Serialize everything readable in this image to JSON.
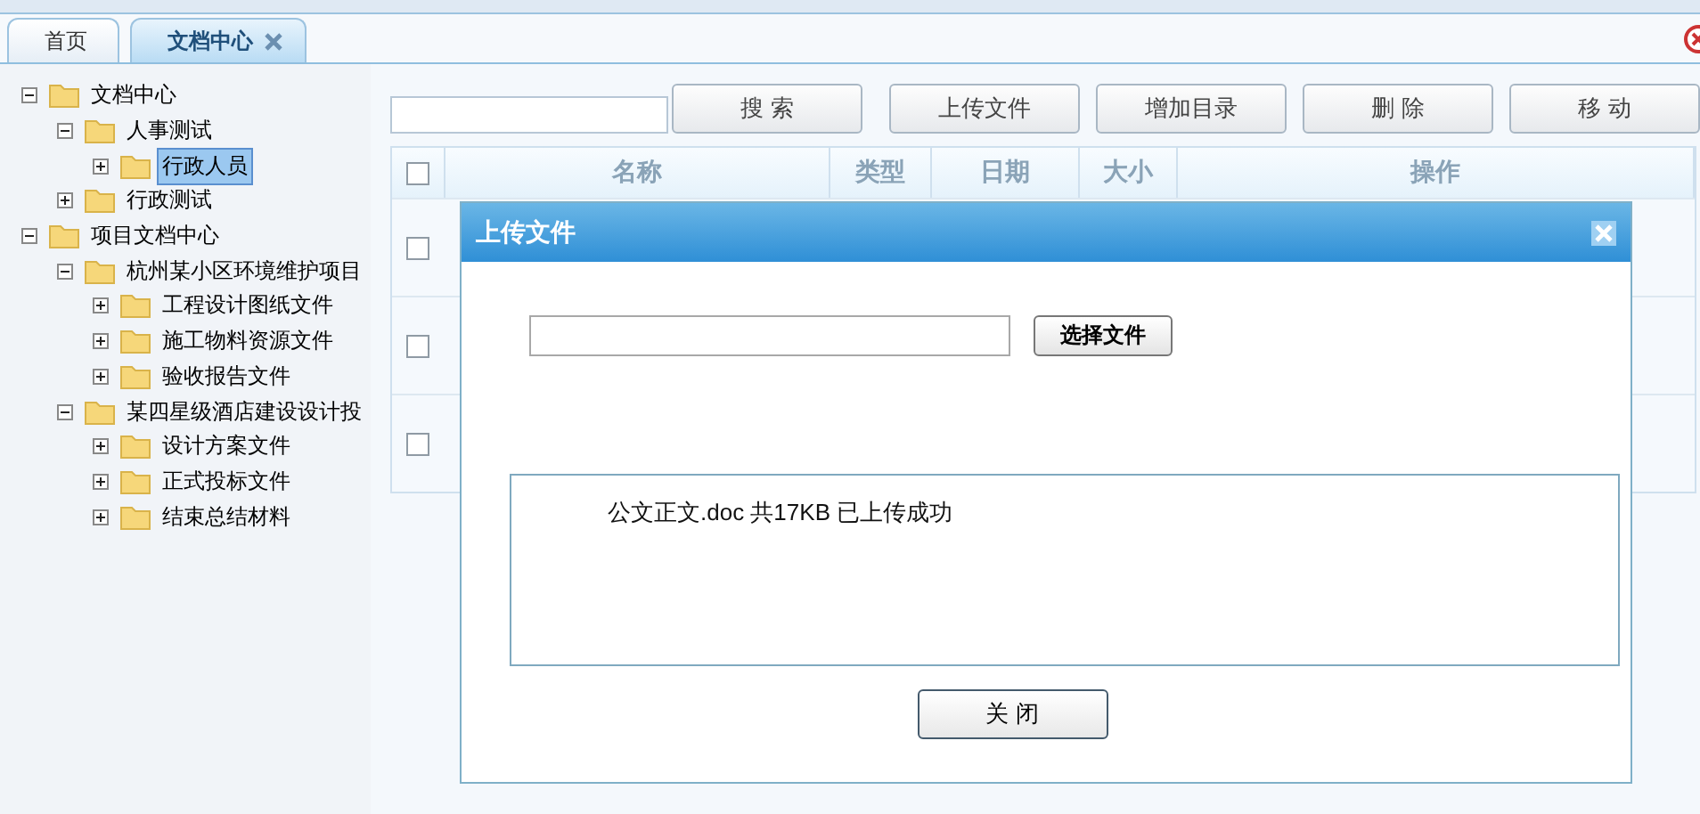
{
  "tabs": [
    {
      "label": "首页",
      "selected": false,
      "closable": false
    },
    {
      "label": "文档中心",
      "selected": true,
      "closable": true
    }
  ],
  "tree": [
    {
      "label": "文档中心",
      "expanded": true,
      "selected": false,
      "children": [
        {
          "label": "人事测试",
          "expanded": true,
          "selected": false,
          "children": [
            {
              "label": "行政人员",
              "expanded": false,
              "selected": true
            }
          ]
        },
        {
          "label": "行政测试",
          "expanded": false,
          "selected": false
        }
      ]
    },
    {
      "label": "项目文档中心",
      "expanded": true,
      "selected": false,
      "children": [
        {
          "label": "杭州某小区环境维护项目",
          "expanded": true,
          "selected": false,
          "children": [
            {
              "label": "工程设计图纸文件",
              "expanded": false,
              "selected": false
            },
            {
              "label": "施工物料资源文件",
              "expanded": false,
              "selected": false
            },
            {
              "label": "验收报告文件",
              "expanded": false,
              "selected": false
            }
          ]
        },
        {
          "label": "某四星级酒店建设设计投",
          "expanded": true,
          "selected": false,
          "children": [
            {
              "label": "设计方案文件",
              "expanded": false,
              "selected": false
            },
            {
              "label": "正式投标文件",
              "expanded": false,
              "selected": false
            },
            {
              "label": "结束总结材料",
              "expanded": false,
              "selected": false
            }
          ]
        }
      ]
    }
  ],
  "toolbar": {
    "search_button": "搜 索",
    "buttons": [
      "上传文件",
      "增加目录",
      "删 除",
      "移 动"
    ]
  },
  "table": {
    "columns": [
      "名称",
      "类型",
      "日期",
      "大小",
      "操作"
    ],
    "rows": [
      {
        "checked": false
      },
      {
        "checked": false
      },
      {
        "checked": false
      }
    ],
    "header_checked": false
  },
  "dialog": {
    "title": "上传文件",
    "choose_button": "选择文件",
    "message": "公文正文.doc 共17KB 已上传成功",
    "close_button": "关 闭"
  }
}
